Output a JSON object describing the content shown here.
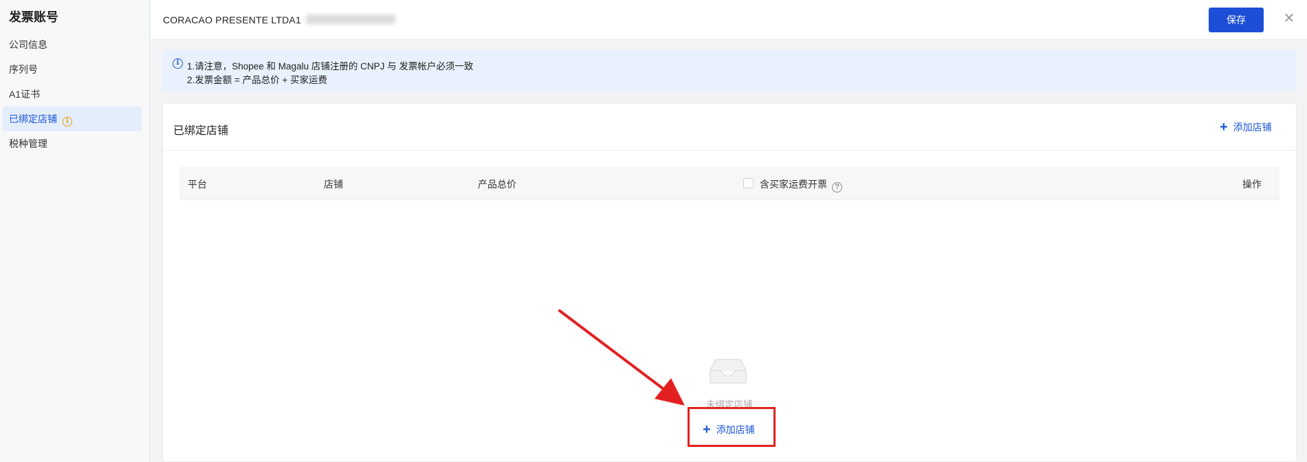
{
  "sidebar": {
    "title": "发票账号",
    "items": [
      {
        "label": "公司信息"
      },
      {
        "label": "序列号"
      },
      {
        "label": "A1证书"
      },
      {
        "label": "已绑定店铺"
      },
      {
        "label": "税种管理"
      }
    ]
  },
  "header": {
    "company_name": "CORACAO PRESENTE LTDA1",
    "save_label": "保存",
    "close_glyph": "✕"
  },
  "notice": {
    "lines": [
      "1.请注意，Shopee 和 Magalu 店铺注册的 CNPJ 与 发票帐户必须一致",
      "2.发票金额 = 产品总价 + 买家运费"
    ]
  },
  "card": {
    "title": "已绑定店铺",
    "add_store_label": "添加店铺"
  },
  "table": {
    "columns": {
      "platform": "平台",
      "store": "店铺",
      "total_price": "产品总价",
      "include_shipping": "含买家运费开票",
      "actions": "操作"
    }
  },
  "empty_state": {
    "text": "未绑定店铺",
    "add_store_label": "添加店铺"
  },
  "colors": {
    "primary": "#1d4ed8",
    "link": "#1a56d6",
    "notice_bg": "#e8f1fd",
    "annotation": "#e32020"
  }
}
